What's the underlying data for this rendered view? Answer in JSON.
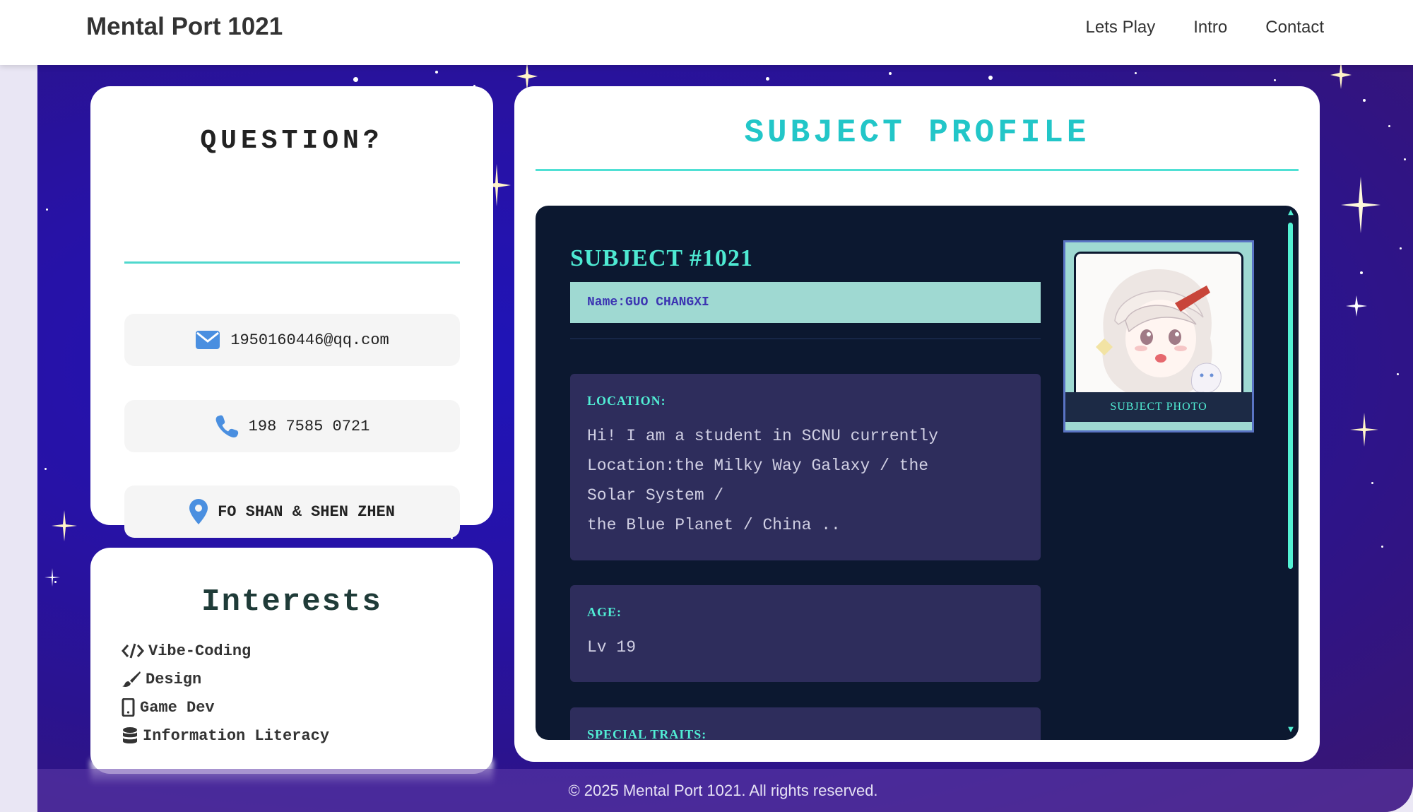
{
  "header": {
    "brand": "Mental Port 1021",
    "nav": [
      "Lets Play",
      "Intro",
      "Contact"
    ]
  },
  "contact": {
    "title": "QUESTION?",
    "email": "1950160446@qq.com",
    "phone": "198 7585 0721",
    "location": "FO SHAN & SHEN ZHEN",
    "icons": [
      "envelope-icon",
      "phone-icon",
      "map-pin-icon"
    ]
  },
  "interests": {
    "title": "Interests",
    "items": [
      {
        "icon": "code-icon",
        "label": "Vibe-Coding"
      },
      {
        "icon": "brush-icon",
        "label": "Design"
      },
      {
        "icon": "mobile-icon",
        "label": "Game Dev"
      },
      {
        "icon": "database-icon",
        "label": "Information Literacy"
      }
    ]
  },
  "profile": {
    "title": "SUBJECT PROFILE",
    "subject_id": "SUBJECT #1021",
    "name": "Name:GUO CHANGXI",
    "photo_caption": "SUBJECT PHOTO",
    "location_label": "LOCATION:",
    "location_text": "Hi! I am a student in SCNU currently\nLocation:the Milky Way Galaxy / the\nSolar System /\nthe Blue Planet / China ..",
    "age_label": "AGE:",
    "age_text": "Lv 19",
    "traits_label": "SPECIAL TRAITS:"
  },
  "footer": {
    "text": "© 2025 Mental Port 1021. All rights reserved."
  },
  "colors": {
    "accent": "#4fd8cd",
    "terminal_bg": "#0c1830",
    "block_bg": "#2e2d5c",
    "space": "#2712a6"
  }
}
